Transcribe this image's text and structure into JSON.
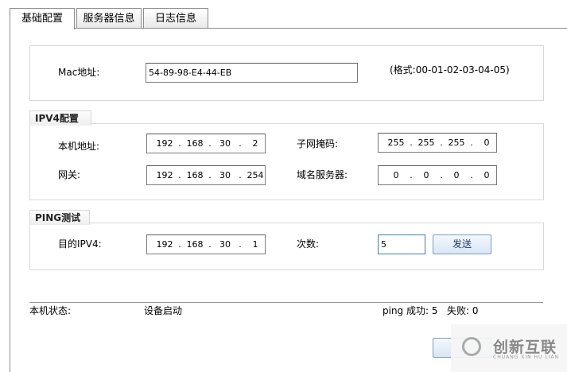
{
  "tabs": [
    "基础配置",
    "服务器信息",
    "日志信息"
  ],
  "mac": {
    "label": "Mac地址:",
    "value": "54-89-98-E4-44-EB",
    "hint": "(格式:00-01-02-03-04-05)"
  },
  "ipv4": {
    "title": "IPV4配置",
    "local_label": "本机地址:",
    "local_ip": [
      "192",
      "168",
      "30",
      "2"
    ],
    "mask_label": "子网掩码:",
    "mask_ip": [
      "255",
      "255",
      "255",
      "0"
    ],
    "gateway_label": "网关:",
    "gateway_ip": [
      "192",
      "168",
      "30",
      "254"
    ],
    "dns_label": "域名服务器:",
    "dns_ip": [
      "0",
      "0",
      "0",
      "0"
    ]
  },
  "ping": {
    "title": "PING测试",
    "target_label": "目的IPV4:",
    "target_ip": [
      "192",
      "168",
      "30",
      "1"
    ],
    "count_label": "次数:",
    "count_value": "5",
    "send_label": "发送"
  },
  "status": {
    "label": "本机状态:",
    "value": "设备启动",
    "ping_success": "ping 成功:  5",
    "ping_fail": "失败:  0"
  },
  "watermark": {
    "text": "创新互联",
    "sub": "CHUANG XIN HU LIAN"
  }
}
